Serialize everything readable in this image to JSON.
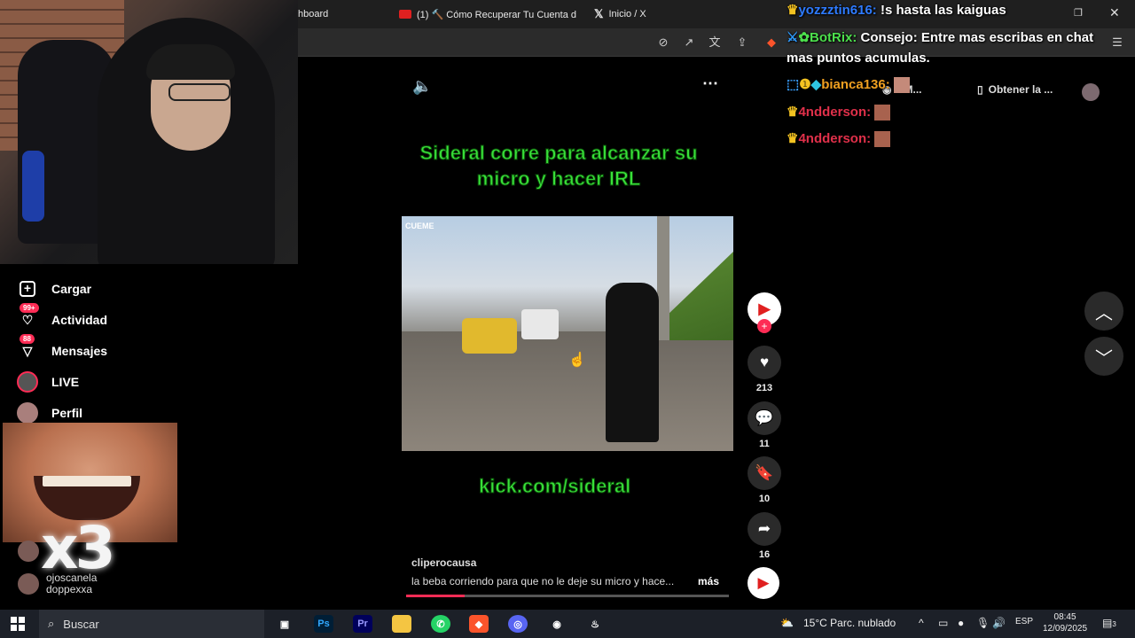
{
  "browser": {
    "tabs": [
      {
        "label": "hboard"
      },
      {
        "label": "(1) 🔨 Cómo Recuperar Tu Cuenta d"
      },
      {
        "label": "Inicio / X"
      }
    ],
    "bookmarks": [
      {
        "label": "r M..."
      },
      {
        "label": "Obtener la ..."
      }
    ]
  },
  "nav": {
    "items": [
      {
        "label": "Cargar",
        "badge": ""
      },
      {
        "label": "Actividad",
        "badge": "99+"
      },
      {
        "label": "Mensajes",
        "badge": "88"
      },
      {
        "label": "LIVE",
        "badge": ""
      },
      {
        "label": "Perfil",
        "badge": ""
      }
    ],
    "following": [
      {
        "label": "ojoscanela"
      },
      {
        "label": "doppexxa"
      }
    ]
  },
  "overlay": {
    "meme_text": "x3"
  },
  "video": {
    "caption_top": "Sideral corre para alcanzar su micro y hacer IRL",
    "caption_bottom": "kick.com/sideral",
    "clip_badge": "CUEME",
    "author": "cliperocausa",
    "description": "la beba corriendo para que no le deje su micro y hace...",
    "more_label": "más",
    "progress_percent": 18,
    "actions": {
      "likes": "213",
      "comments": "11",
      "saves": "10",
      "shares": "16"
    }
  },
  "chat": [
    {
      "user": "yozzztin616:",
      "message": "!s hasta las kaiguas",
      "user_color": "#2e7bff"
    },
    {
      "user": "BotRix:",
      "message": "Consejo: Entre mas escribas en chat mas puntos acumulas.",
      "user_color": "#4de04d"
    },
    {
      "user": "bianca136:",
      "message": "",
      "user_color": "#f0a020"
    },
    {
      "user": "4ndderson:",
      "message": "",
      "user_color": "#e0304a"
    },
    {
      "user": "4ndderson:",
      "message": "",
      "user_color": "#e0304a"
    }
  ],
  "taskbar": {
    "search_placeholder": "Buscar",
    "weather": "15°C  Parc. nublado",
    "language": "ESP",
    "time": "08:45",
    "date": "12/09/2025",
    "notification_count": "3"
  }
}
